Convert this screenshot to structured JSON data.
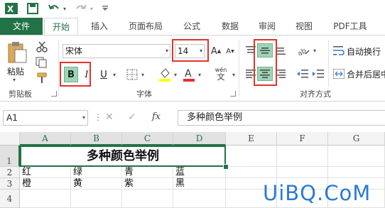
{
  "ribbon_tabs": [
    "文件",
    "开始",
    "插入",
    "页面布局",
    "公式",
    "数据",
    "审阅",
    "视图",
    "PDF工具"
  ],
  "clipboard": {
    "paste_label": "粘贴",
    "group_label": "剪贴板"
  },
  "font": {
    "family": "宋体",
    "size": "14",
    "group_label": "字体",
    "bold": "B",
    "italic": "I",
    "underline": "U",
    "phonetic": "wén",
    "increase": "A",
    "decrease": "A"
  },
  "alignment": {
    "wrap_text": "自动换行",
    "merge_center": "合并后居中",
    "group_label": "对齐方式"
  },
  "formula_bar": {
    "name_box": "A1",
    "fx": "fx",
    "content": "多种颜色举例"
  },
  "columns": [
    "A",
    "B",
    "C",
    "D",
    "E",
    "F",
    "G"
  ],
  "rows": [
    "1",
    "2",
    "3",
    "4"
  ],
  "cells": {
    "title": "多种颜色举例",
    "row2": [
      "红",
      "绿",
      "青",
      "蓝"
    ],
    "row3": [
      "橙",
      "黄",
      "紫",
      "黑"
    ]
  },
  "watermark": "UiBQ.CoM",
  "colors": {
    "accent": "#217346",
    "highlight_box": "#e5322d",
    "watermark": "#2a7bd4"
  }
}
